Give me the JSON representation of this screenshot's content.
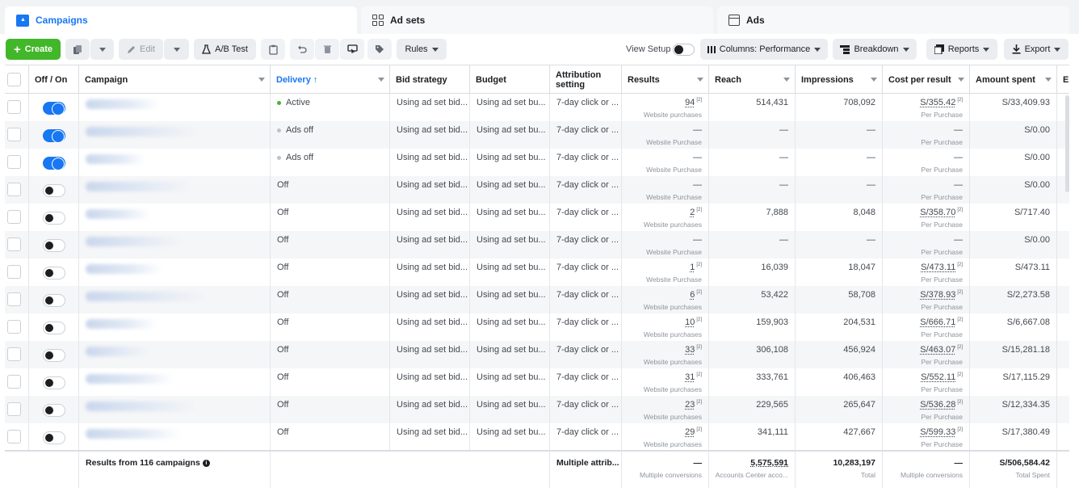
{
  "tabs": [
    {
      "label": "Campaigns",
      "icon": "campaign-icon"
    },
    {
      "label": "Ad sets",
      "icon": "adsets-grid-icon"
    },
    {
      "label": "Ads",
      "icon": "ads-window-icon"
    }
  ],
  "toolbar": {
    "create_label": "Create",
    "edit_label": "Edit",
    "abtest_label": "A/B Test",
    "rules_label": "Rules",
    "view_setup_label": "View Setup",
    "columns_label": "Columns: Performance",
    "breakdown_label": "Breakdown",
    "reports_label": "Reports",
    "export_label": "Export"
  },
  "columns": {
    "off_on": "Off / On",
    "campaign": "Campaign",
    "delivery": "Delivery ↑",
    "bid_strategy": "Bid strategy",
    "budget": "Budget",
    "attribution": "Attribution setting",
    "results": "Results",
    "reach": "Reach",
    "impressions": "Impressions",
    "cost_per_result": "Cost per result",
    "amount_spent": "Amount spent",
    "ends": "En"
  },
  "rows": [
    {
      "on": true,
      "delivery": "Active",
      "dot": "green",
      "bid": "Using ad set bid...",
      "budget": "Using ad set bu...",
      "attr": "7-day click or ...",
      "results": "94",
      "results_link": true,
      "results_sub": "Website purchases",
      "reach": "514,431",
      "impressions": "708,092",
      "cpr": "S/355.42",
      "cpr_link": true,
      "cpr_sub": "Per Purchase",
      "spent": "S/33,409.93"
    },
    {
      "on": true,
      "delivery": "Ads off",
      "dot": "grey",
      "bid": "Using ad set bid...",
      "budget": "Using ad set bu...",
      "attr": "7-day click or ...",
      "results": "—",
      "results_link": false,
      "results_sub": "Website Purchase",
      "reach": "—",
      "impressions": "—",
      "cpr": "—",
      "cpr_link": false,
      "cpr_sub": "Per Purchase",
      "spent": "S/0.00"
    },
    {
      "on": true,
      "delivery": "Ads off",
      "dot": "grey",
      "bid": "Using ad set bid...",
      "budget": "Using ad set bu...",
      "attr": "7-day click or ...",
      "results": "—",
      "results_link": false,
      "results_sub": "Website Purchase",
      "reach": "—",
      "impressions": "—",
      "cpr": "—",
      "cpr_link": false,
      "cpr_sub": "Per Purchase",
      "spent": "S/0.00"
    },
    {
      "on": false,
      "delivery": "Off",
      "dot": "",
      "bid": "Using ad set bid...",
      "budget": "Using ad set bu...",
      "attr": "7-day click or ...",
      "results": "—",
      "results_link": false,
      "results_sub": "Website Purchase",
      "reach": "—",
      "impressions": "—",
      "cpr": "—",
      "cpr_link": false,
      "cpr_sub": "Per Purchase",
      "spent": "S/0.00"
    },
    {
      "on": false,
      "delivery": "Off",
      "dot": "",
      "bid": "Using ad set bid...",
      "budget": "Using ad set bu...",
      "attr": "7-day click or ...",
      "results": "2",
      "results_link": true,
      "results_sub": "Website purchases",
      "reach": "7,888",
      "impressions": "8,048",
      "cpr": "S/358.70",
      "cpr_link": true,
      "cpr_sub": "Per Purchase",
      "spent": "S/717.40"
    },
    {
      "on": false,
      "delivery": "Off",
      "dot": "",
      "bid": "Using ad set bid...",
      "budget": "Using ad set bu...",
      "attr": "7-day click or ...",
      "results": "—",
      "results_link": false,
      "results_sub": "Website Purchase",
      "reach": "—",
      "impressions": "—",
      "cpr": "—",
      "cpr_link": false,
      "cpr_sub": "Per Purchase",
      "spent": "S/0.00"
    },
    {
      "on": false,
      "delivery": "Off",
      "dot": "",
      "bid": "Using ad set bid...",
      "budget": "Using ad set bu...",
      "attr": "7-day click or ...",
      "results": "1",
      "results_link": true,
      "results_sub": "Website Purchase",
      "reach": "16,039",
      "impressions": "18,047",
      "cpr": "S/473.11",
      "cpr_link": true,
      "cpr_sub": "Per Purchase",
      "spent": "S/473.11"
    },
    {
      "on": false,
      "delivery": "Off",
      "dot": "",
      "bid": "Using ad set bid...",
      "budget": "Using ad set bu...",
      "attr": "7-day click or ...",
      "results": "6",
      "results_link": true,
      "results_sub": "Website purchases",
      "reach": "53,422",
      "impressions": "58,708",
      "cpr": "S/378.93",
      "cpr_link": true,
      "cpr_sub": "Per Purchase",
      "spent": "S/2,273.58"
    },
    {
      "on": false,
      "delivery": "Off",
      "dot": "",
      "bid": "Using ad set bid...",
      "budget": "Using ad set bu...",
      "attr": "7-day click or ...",
      "results": "10",
      "results_link": true,
      "results_sub": "Website purchases",
      "reach": "159,903",
      "impressions": "204,531",
      "cpr": "S/666.71",
      "cpr_link": true,
      "cpr_sub": "Per Purchase",
      "spent": "S/6,667.08"
    },
    {
      "on": false,
      "delivery": "Off",
      "dot": "",
      "bid": "Using ad set bid...",
      "budget": "Using ad set bu...",
      "attr": "7-day click or ...",
      "results": "33",
      "results_link": true,
      "results_sub": "Website purchases",
      "reach": "306,108",
      "impressions": "456,924",
      "cpr": "S/463.07",
      "cpr_link": true,
      "cpr_sub": "Per Purchase",
      "spent": "S/15,281.18"
    },
    {
      "on": false,
      "delivery": "Off",
      "dot": "",
      "bid": "Using ad set bid...",
      "budget": "Using ad set bu...",
      "attr": "7-day click or ...",
      "results": "31",
      "results_link": true,
      "results_sub": "Website purchases",
      "reach": "333,761",
      "impressions": "406,463",
      "cpr": "S/552.11",
      "cpr_link": true,
      "cpr_sub": "Per Purchase",
      "spent": "S/17,115.29"
    },
    {
      "on": false,
      "delivery": "Off",
      "dot": "",
      "bid": "Using ad set bid...",
      "budget": "Using ad set bu...",
      "attr": "7-day click or ...",
      "results": "23",
      "results_link": true,
      "results_sub": "Website purchases",
      "reach": "229,565",
      "impressions": "265,647",
      "cpr": "S/536.28",
      "cpr_link": true,
      "cpr_sub": "Per Purchase",
      "spent": "S/12,334.35"
    },
    {
      "on": false,
      "delivery": "Off",
      "dot": "",
      "bid": "Using ad set bid...",
      "budget": "Using ad set bu...",
      "attr": "7-day click or ...",
      "results": "29",
      "results_link": true,
      "results_sub": "Website purchases",
      "reach": "341,111",
      "impressions": "427,667",
      "cpr": "S/599.33",
      "cpr_link": true,
      "cpr_sub": "Per Purchase",
      "spent": "S/17,380.49"
    }
  ],
  "totals": {
    "label": "Results from 116 campaigns",
    "attribution": "Multiple attrib...",
    "results": "—",
    "results_sub": "Multiple conversions",
    "reach": "5,575,591",
    "reach_sub": "Accounts Center acco...",
    "impressions": "10,283,197",
    "impressions_sub": "Total",
    "cpr": "—",
    "cpr_sub": "Multiple conversions",
    "spent": "S/506,584.42",
    "spent_sub": "Total Spent"
  },
  "colors": {
    "accent": "#1877f2",
    "create": "#42b72a",
    "active_dot": "#42b72a"
  }
}
